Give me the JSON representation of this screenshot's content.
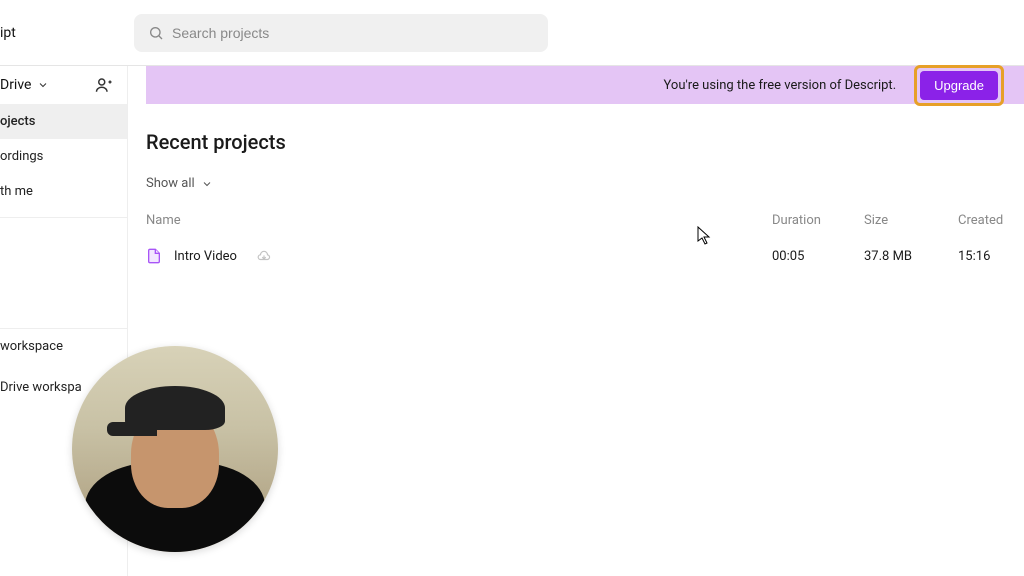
{
  "app_title": "ipt",
  "search": {
    "placeholder": "Search projects"
  },
  "drive": {
    "label": "Drive"
  },
  "sidebar": {
    "items": [
      {
        "label": "ojects"
      },
      {
        "label": "ordings"
      },
      {
        "label": "th me"
      }
    ],
    "bottom": [
      {
        "label": "workspace"
      },
      {
        "label": "Drive workspa"
      }
    ]
  },
  "banner": {
    "text": "You're using the free version of Descript.",
    "upgrade_label": "Upgrade"
  },
  "main": {
    "recent_title": "Recent projects",
    "filter_label": "Show all",
    "columns": {
      "name": "Name",
      "duration": "Duration",
      "size": "Size",
      "created": "Created"
    },
    "rows": [
      {
        "name": "Intro Video",
        "duration": "00:05",
        "size": "37.8 MB",
        "created": "15:16"
      }
    ]
  },
  "colors": {
    "accent": "#8b22e8",
    "banner_bg": "#e4c5f5",
    "highlight_border": "#e7a028"
  }
}
